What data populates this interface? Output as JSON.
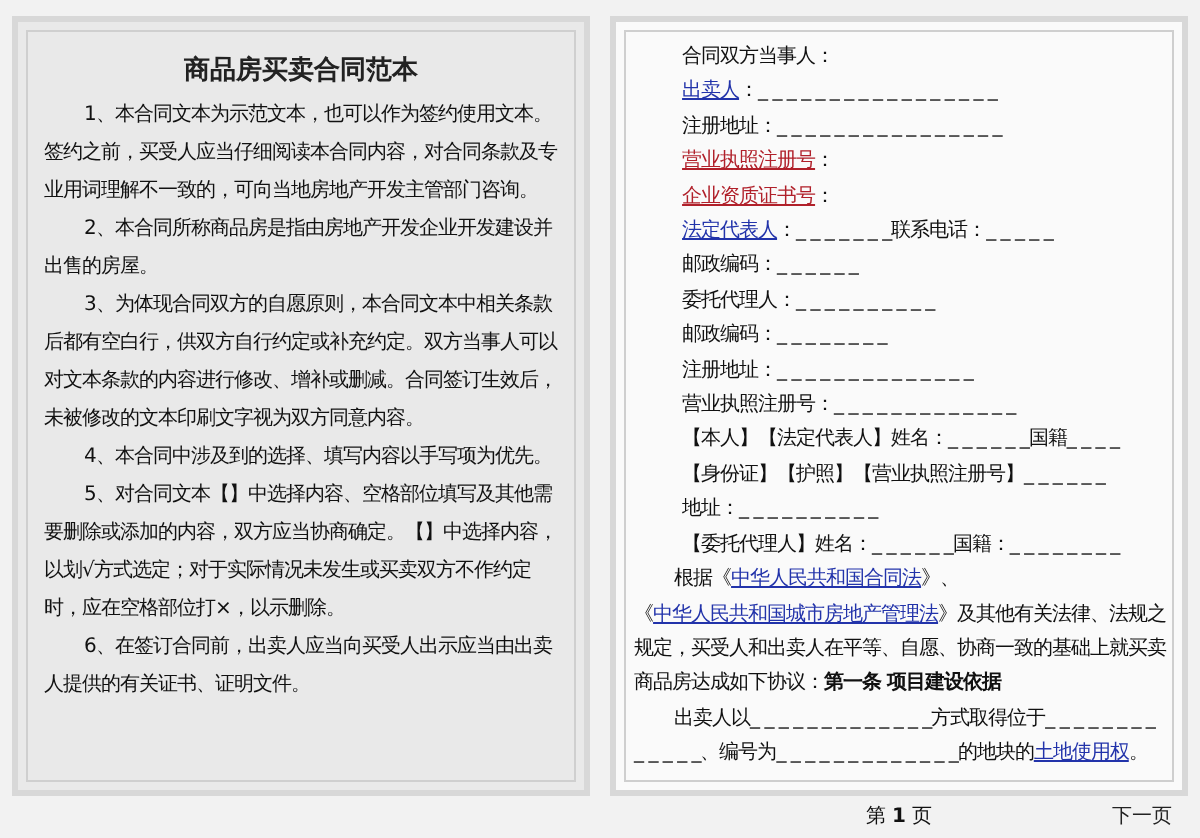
{
  "left_page": {
    "title": "商品房买卖合同范本",
    "paragraphs": [
      "1、本合同文本为示范文本，也可以作为签约使用文本。签约之前，买受人应当仔细阅读本合同内容，对合同条款及专业用词理解不一致的，可向当地房地产开发主管部门咨询。",
      "2、本合同所称商品房是指由房地产开发企业开发建设并出售的房屋。",
      "3、为体现合同双方的自愿原则，本合同文本中相关条款后都有空白行，供双方自行约定或补充约定。双方当事人可以对文本条款的内容进行修改、增补或删减。合同签订生效后，未被修改的文本印刷文字视为双方同意内容。",
      "4、本合同中涉及到的选择、填写内容以手写项为优先。",
      "5、对合同文本【】中选择内容、空格部位填写及其他需要删除或添加的内容，双方应当协商确定。【】中选择内容，以划√方式选定；对于实际情况未发生或买卖双方不作约定时，应在空格部位打×，以示删除。",
      "6、在签订合同前，出卖人应当向买受人出示应当由出卖人提供的有关证书、证明文件。"
    ]
  },
  "right_page": {
    "lines": [
      {
        "kind": "field",
        "parts": [
          {
            "kind": "text",
            "text": "合同双方当事人："
          }
        ]
      },
      {
        "kind": "field",
        "parts": [
          {
            "kind": "link",
            "text": "出卖人",
            "color": "#2233aa"
          },
          {
            "kind": "text",
            "text": "：_ _ _ _ _ _ _ _ _ _ _ _ _ _ _ _ _"
          }
        ]
      },
      {
        "kind": "field",
        "parts": [
          {
            "kind": "text",
            "text": "注册地址：_ _ _ _ _ _ _ _ _ _ _ _ _ _ _ _"
          }
        ]
      },
      {
        "kind": "field",
        "parts": [
          {
            "kind": "link",
            "text": "营业执照注册号",
            "color": "#b0202a"
          },
          {
            "kind": "text",
            "text": "："
          }
        ]
      },
      {
        "kind": "field",
        "parts": [
          {
            "kind": "link",
            "text": "企业资质证书号",
            "color": "#b0202a"
          },
          {
            "kind": "text",
            "text": "："
          }
        ]
      },
      {
        "kind": "field",
        "parts": [
          {
            "kind": "link",
            "text": "法定代表人",
            "color": "#2233aa"
          },
          {
            "kind": "text",
            "text": "：_ _ _ _ _ _ _联系电话：_ _ _ _ _"
          }
        ]
      },
      {
        "kind": "field",
        "parts": [
          {
            "kind": "text",
            "text": "邮政编码：_ _ _ _ _ _"
          }
        ]
      },
      {
        "kind": "field",
        "parts": [
          {
            "kind": "text",
            "text": "委托代理人：_ _ _ _ _ _ _ _ _ _"
          }
        ]
      },
      {
        "kind": "field",
        "parts": [
          {
            "kind": "text",
            "text": "邮政编码：_ _ _ _ _ _ _ _"
          }
        ]
      },
      {
        "kind": "field",
        "parts": [
          {
            "kind": "text",
            "text": "注册地址：_ _ _ _ _ _ _ _ _ _ _ _ _ _"
          }
        ]
      },
      {
        "kind": "field",
        "parts": [
          {
            "kind": "text",
            "text": "营业执照注册号：_ _ _ _ _ _ _ _ _ _ _ _ _"
          }
        ]
      },
      {
        "kind": "option",
        "parts": [
          {
            "kind": "text",
            "text": "【本人】【法定代表人】姓名：_ _ _ _ _ _国籍_ _ _ _"
          }
        ]
      },
      {
        "kind": "option",
        "parts": [
          {
            "kind": "text",
            "text": "【身份证】【护照】【营业执照注册号】_ _ _ _ _ _"
          }
        ]
      },
      {
        "kind": "field",
        "parts": [
          {
            "kind": "text",
            "text": "地址：_ _ _ _ _ _ _ _ _ _"
          }
        ]
      },
      {
        "kind": "option",
        "parts": [
          {
            "kind": "text",
            "text": "【委托代理人】姓名：_ _ _ _ _ _国籍：_ _ _ _ _ _ _ _"
          }
        ]
      },
      {
        "kind": "paragraph",
        "parts": [
          {
            "kind": "text",
            "text": "根据《"
          },
          {
            "kind": "link",
            "text": "中华人民共和国合同法",
            "color": "#2233aa"
          },
          {
            "kind": "text",
            "text": "》、《"
          },
          {
            "kind": "link",
            "text": "中华人民共和国城市房地产管理法",
            "color": "#2233aa"
          },
          {
            "kind": "text",
            "text": "》及其他有关法律、法规之规定，买受人和出卖人在平等、自愿、协商一致的基础上就买卖商品房达成如下协议：**第一条  项目建设依据**"
          }
        ]
      },
      {
        "kind": "paragraph",
        "parts": [
          {
            "kind": "text",
            "text": "出卖人以_ _ _ _ _ _ _ _ _ _ _ _ _方式取得位于_ _ _ _ _ _ _ _ _ _ _ _ _、编号为_ _ _ _ _ _ _ _ _ _ _ _ _的地块的"
          },
          {
            "kind": "link",
            "text": "土地使用权",
            "color": "#2233aa"
          },
          {
            "kind": "text",
            "text": "。"
          }
        ]
      }
    ]
  },
  "pager": {
    "page_label": "第 **1** 页",
    "next": "下一页"
  }
}
